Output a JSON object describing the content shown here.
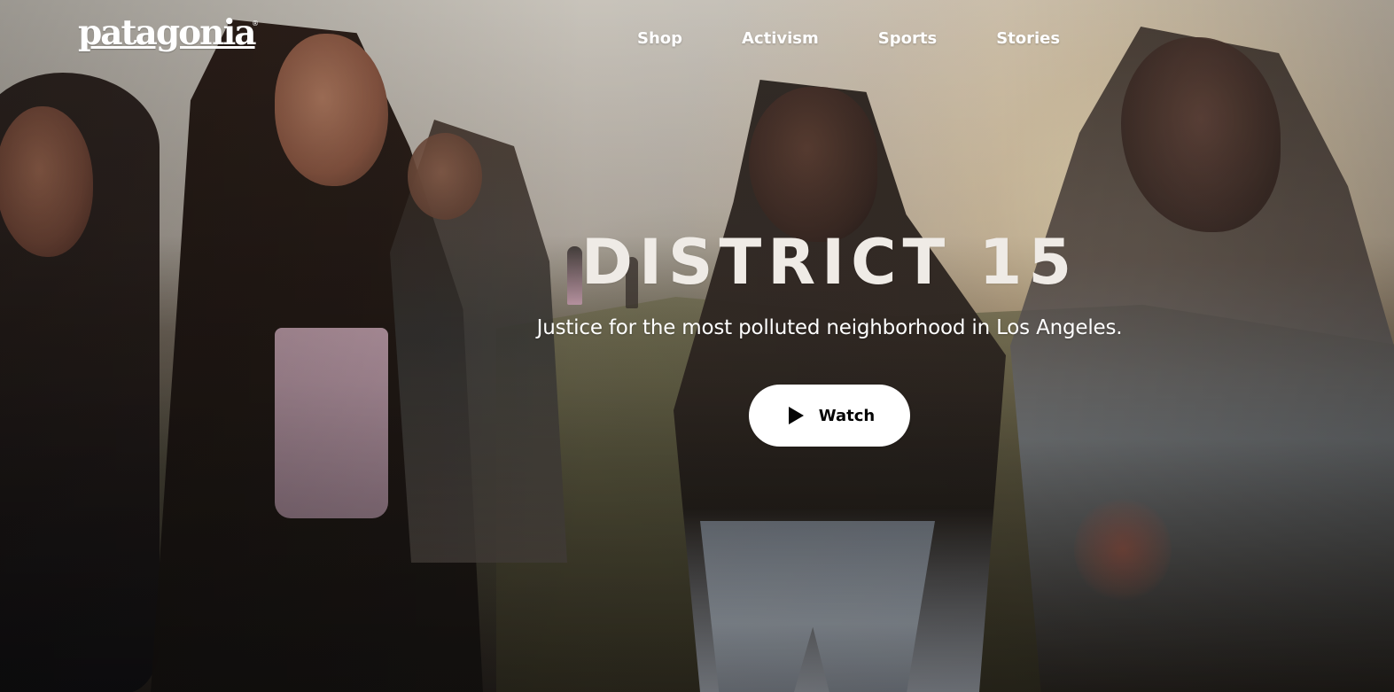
{
  "brand": {
    "logo": "patagonia",
    "logo_mark": "®"
  },
  "nav": {
    "items": [
      {
        "label": "Shop"
      },
      {
        "label": "Activism"
      },
      {
        "label": "Sports"
      },
      {
        "label": "Stories"
      }
    ]
  },
  "hero": {
    "title": "DISTRICT 15",
    "subtitle": "Justice for the most polluted neighborhood in Los Angeles.",
    "watch_label": "Watch"
  },
  "icons": {
    "play": "play-icon"
  },
  "colors": {
    "text": "#ffffff",
    "button_background": "#ffffff",
    "button_text": "#050505"
  }
}
